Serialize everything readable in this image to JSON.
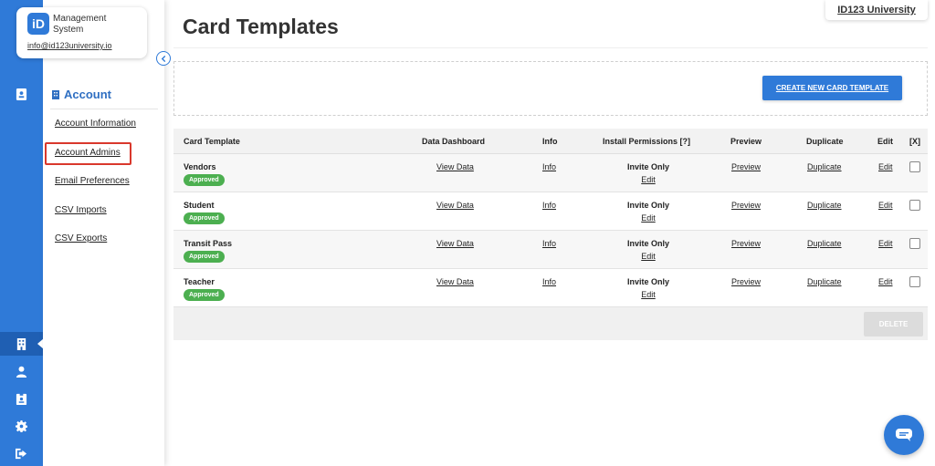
{
  "brand": {
    "logo_text": "iD",
    "name_line1": "Management",
    "name_line2": "System",
    "email": "info@id123university.io"
  },
  "org": {
    "name": "ID123 University"
  },
  "sidebar": {
    "section_title": "Account",
    "items": [
      {
        "label": "Account Information"
      },
      {
        "label": "Account Admins"
      },
      {
        "label": "Email Preferences"
      },
      {
        "label": "CSV Imports"
      },
      {
        "label": "CSV Exports"
      }
    ]
  },
  "page": {
    "title": "Card Templates",
    "create_button": "CREATE NEW CARD TEMPLATE",
    "delete_button": "DELETE"
  },
  "table": {
    "headers": {
      "template": "Card Template",
      "dashboard": "Data Dashboard",
      "info": "Info",
      "permissions": "Install Permissions [?]",
      "preview": "Preview",
      "duplicate": "Duplicate",
      "edit": "Edit",
      "x": "[X]"
    },
    "rows": [
      {
        "name": "Vendors",
        "status": "Approved",
        "dashboard": "View Data",
        "info": "Info",
        "permission": "Invite Only",
        "permission_edit": "Edit",
        "preview": "Preview",
        "duplicate": "Duplicate",
        "edit": "Edit"
      },
      {
        "name": "Student",
        "status": "Approved",
        "dashboard": "View Data",
        "info": "Info",
        "permission": "Invite Only",
        "permission_edit": "Edit",
        "preview": "Preview",
        "duplicate": "Duplicate",
        "edit": "Edit"
      },
      {
        "name": "Transit Pass",
        "status": "Approved",
        "dashboard": "View Data",
        "info": "Info",
        "permission": "Invite Only",
        "permission_edit": "Edit",
        "preview": "Preview",
        "duplicate": "Duplicate",
        "edit": "Edit"
      },
      {
        "name": "Teacher",
        "status": "Approved",
        "dashboard": "View Data",
        "info": "Info",
        "permission": "Invite Only",
        "permission_edit": "Edit",
        "preview": "Preview",
        "duplicate": "Duplicate",
        "edit": "Edit"
      }
    ]
  },
  "rail": {
    "icons": [
      "id-card-icon",
      "building-icon",
      "user-icon",
      "id-badge-icon",
      "gear-icon",
      "logout-icon"
    ]
  },
  "colors": {
    "primary": "#2f7ad8",
    "approved": "#4caf50",
    "highlight": "#d9382c"
  }
}
